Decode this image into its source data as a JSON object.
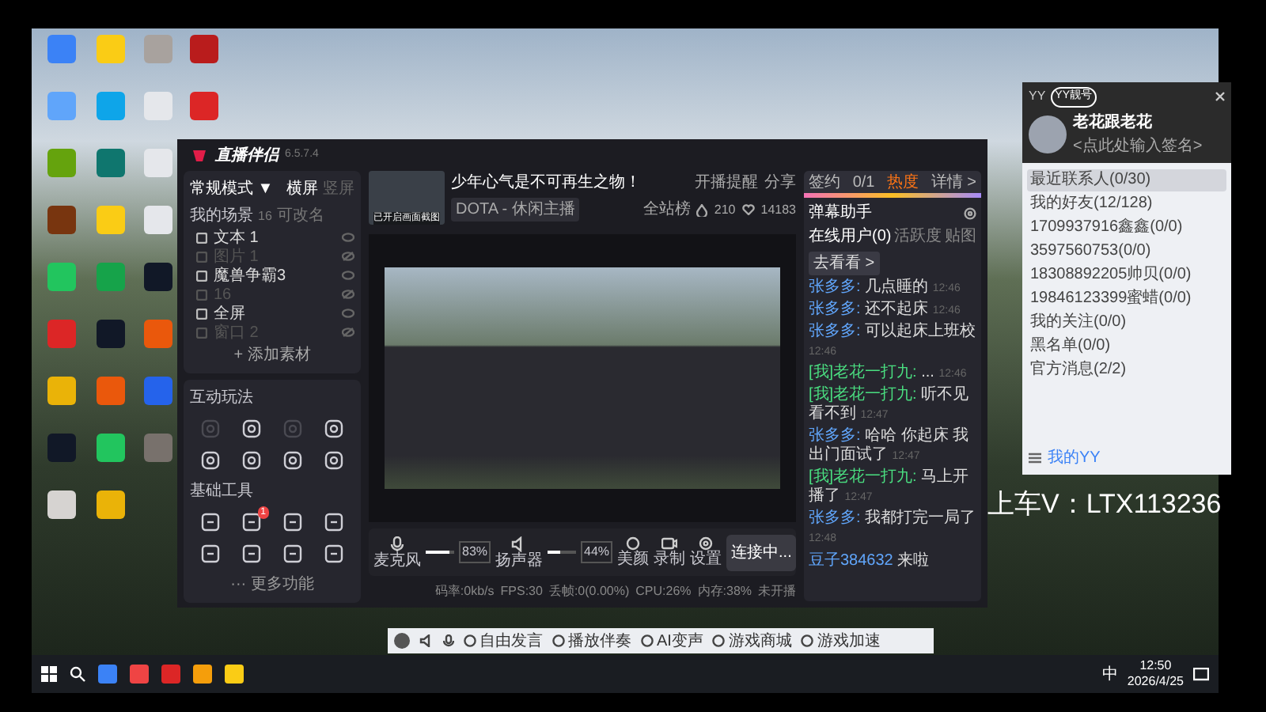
{
  "desktop_icons": [
    {
      "color": "#3b82f6"
    },
    {
      "color": "#facc15"
    },
    {
      "color": "#a8a29e"
    },
    {
      "color": "#b91c1c"
    },
    {
      "color": "#60a5fa"
    },
    {
      "color": "#0ea5e9"
    },
    {
      "color": "#e5e7eb"
    },
    {
      "color": "#dc2626"
    },
    {
      "color": "#65a30d"
    },
    {
      "color": "#0f766e"
    },
    {
      "color": "#e5e7eb"
    },
    {
      "color": "#78350f"
    },
    {
      "color": "#facc15"
    },
    {
      "color": "#e5e7eb"
    },
    {
      "color": "#22c55e"
    },
    {
      "color": "#16a34a"
    },
    {
      "color": "#111827"
    },
    {
      "color": "#dc2626"
    },
    {
      "color": "#111827"
    },
    {
      "color": "#ea580c"
    },
    {
      "color": "#eab308"
    },
    {
      "color": "#ea580c"
    },
    {
      "color": "#2563eb"
    },
    {
      "color": "#111827"
    },
    {
      "color": "#22c55e"
    },
    {
      "color": "#78716c"
    },
    {
      "color": "#d6d3d1"
    },
    {
      "color": "#eab308"
    }
  ],
  "app": {
    "title": "直播伴侣",
    "version": "6.5.7.4",
    "left": {
      "mode": "常规模式 ▼",
      "orientations": [
        {
          "label": "横屏",
          "selected": true
        },
        {
          "label": "竖屏",
          "selected": false
        }
      ],
      "scenes_title": "我的场景",
      "scenes_count": "16",
      "scenes_hint": "可改名",
      "scenes": [
        {
          "name": "文本 1",
          "visible": true
        },
        {
          "name": "图片 1",
          "visible": false
        },
        {
          "name": "魔兽争霸3",
          "visible": true
        },
        {
          "name": "16",
          "visible": false
        },
        {
          "name": "全屏",
          "visible": true
        },
        {
          "name": "窗口 2",
          "visible": false
        }
      ],
      "add_source": "+ 添加素材",
      "interaction_title": "互动玩法",
      "interaction_tools": [
        {
          "disabled": true
        },
        {
          "disabled": false
        },
        {
          "disabled": true
        },
        {
          "disabled": false
        },
        {
          "disabled": false
        },
        {
          "disabled": false
        },
        {
          "disabled": false
        },
        {
          "disabled": false
        }
      ],
      "basic_title": "基础工具",
      "basic_tools": [
        {
          "disabled": false
        },
        {
          "disabled": false
        },
        {
          "disabled": false
        },
        {
          "disabled": false
        },
        {
          "disabled": false
        },
        {
          "disabled": false
        },
        {
          "disabled": false
        },
        {
          "disabled": false
        }
      ],
      "task_badge": "1",
      "more": "··· 更多功能"
    },
    "center": {
      "thumbnail_caption": "已开启画面截图",
      "stream_title": "少年心气是不可再生之物！",
      "category": "DOTA - 休闲主播",
      "reminder": "开播提醒",
      "share": "分享",
      "rank": "全站榜",
      "likes": "210",
      "hearts": "14183",
      "mic": {
        "label": "麦克风",
        "level": 0.83,
        "reading": "83%"
      },
      "speaker": {
        "label": "扬声器",
        "level": 0.44,
        "reading": "44%"
      },
      "tools": [
        "美颜",
        "录制",
        "设置"
      ],
      "connect": "连接中...",
      "status": [
        "码率:0kb/s",
        "FPS:30",
        "丢帧:0(0.00%)",
        "CPU:26%",
        "内存:38%",
        "未开播"
      ]
    },
    "right": {
      "tabs_top": [
        "签约",
        "0/1",
        "热度",
        "详情 >"
      ],
      "title": "弹幕助手",
      "tabs": [
        {
          "label": "在线用户(0)",
          "selected": true
        },
        {
          "label": "活跃度",
          "selected": false
        },
        {
          "label": "贴图",
          "selected": false
        }
      ],
      "promo_link": "去看看 >",
      "messages": [
        {
          "kind": "viewer",
          "user": "张多多:",
          "text": "几点睡的",
          "time": "12:46"
        },
        {
          "kind": "viewer",
          "user": "张多多:",
          "text": "还不起床",
          "time": "12:46"
        },
        {
          "kind": "viewer",
          "user": "张多多:",
          "text": "可以起床上班校",
          "time": "12:46"
        },
        {
          "kind": "self",
          "user": "[我]老花一打九:",
          "text": "...",
          "time": "12:46"
        },
        {
          "kind": "self",
          "user": "[我]老花一打九:",
          "text": "听不见看不到",
          "time": "12:47"
        },
        {
          "kind": "viewer",
          "user": "张多多:",
          "text": "哈哈 你起床 我出门面试了",
          "time": "12:47"
        },
        {
          "kind": "self",
          "user": "[我]老花一打九:",
          "text": "马上开播了",
          "time": "12:47"
        },
        {
          "kind": "viewer",
          "user": "张多多:",
          "text": "我都打完一局了",
          "time": "12:48"
        }
      ],
      "join": {
        "user": "豆子384632",
        "text": "来啦"
      }
    }
  },
  "overlay_text": "上车V：LTX113236",
  "yy": {
    "title": "YY",
    "badge": "YY靓号",
    "name": "老花跟老花",
    "signature": "<点此处输入签名>",
    "groups": [
      {
        "label": "最近联系人(0/30)",
        "selected": true
      },
      {
        "label": "我的好友(12/128)",
        "selected": false
      },
      {
        "label": "1709937916鑫鑫(0/0)",
        "selected": false
      },
      {
        "label": "3597560753(0/0)",
        "selected": false
      },
      {
        "label": "18308892205帅贝(0/0)",
        "selected": false
      },
      {
        "label": "19846123399蜜蜡(0/0)",
        "selected": false
      },
      {
        "label": "我的关注(0/0)",
        "selected": false
      },
      {
        "label": "黑名单(0/0)",
        "selected": false
      },
      {
        "label": "官方消息(2/2)",
        "selected": false
      }
    ],
    "footer": "我的YY"
  },
  "yy_toolbar": [
    "自由发言",
    "播放伴奏",
    "AI变声",
    "游戏商城",
    "游戏加速"
  ],
  "taskbar": {
    "ime": "中",
    "time": "12:50",
    "date": "2026/4/25"
  }
}
